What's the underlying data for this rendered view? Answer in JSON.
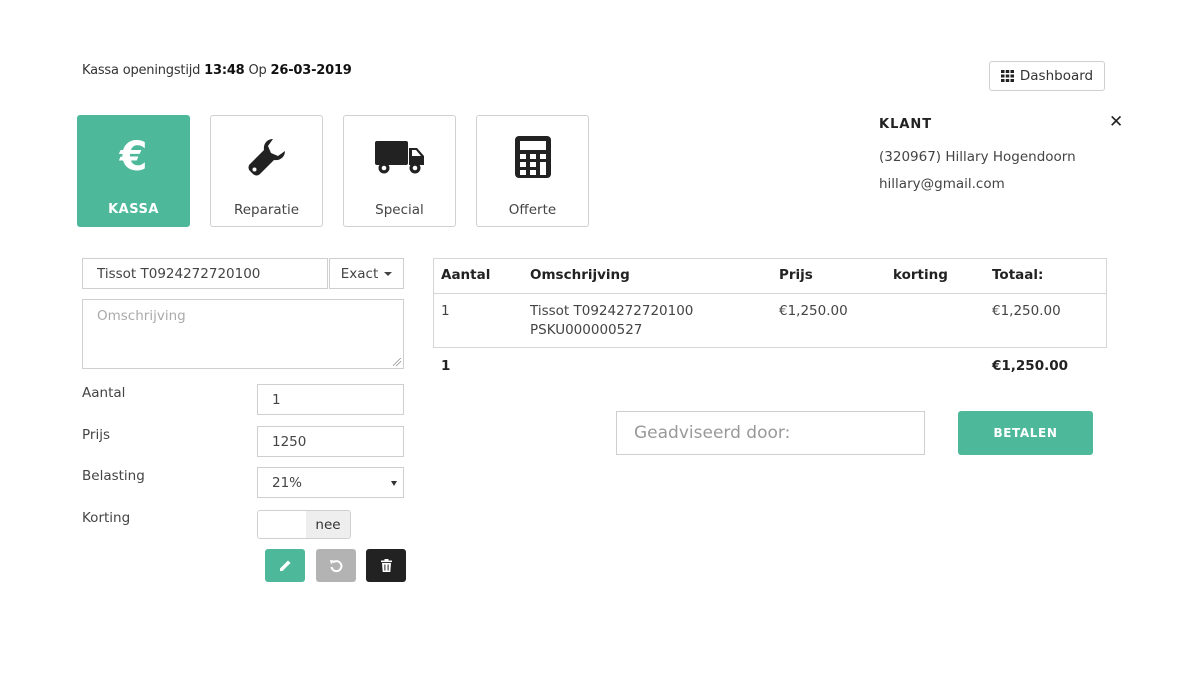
{
  "header": {
    "opening_prefix": "Kassa openingstijd",
    "opening_time": "13:48",
    "opening_on": "Op",
    "opening_date": "26-03-2019",
    "dashboard_label": "Dashboard"
  },
  "tiles": [
    {
      "label": "KASSA",
      "icon": "euro-icon",
      "active": true
    },
    {
      "label": "Reparatie",
      "icon": "wrench-icon",
      "active": false
    },
    {
      "label": "Special",
      "icon": "truck-icon",
      "active": false
    },
    {
      "label": "Offerte",
      "icon": "calculator-icon",
      "active": false
    }
  ],
  "klant": {
    "title": "KLANT",
    "name": "(320967) Hillary Hogendoorn",
    "email": "hillary@gmail.com"
  },
  "form": {
    "product_value": "Tissot T0924272720100",
    "match_mode": "Exact",
    "omschrijving_placeholder": "Omschrijving",
    "aantal_label": "Aantal",
    "aantal_value": "1",
    "prijs_label": "Prijs",
    "prijs_value": "1250",
    "belasting_label": "Belasting",
    "belasting_value": "21%",
    "korting_label": "Korting",
    "korting_value": "nee"
  },
  "table": {
    "headers": [
      "Aantal",
      "Omschrijving",
      "Prijs",
      "korting",
      "Totaal:"
    ],
    "rows": [
      {
        "aantal": "1",
        "omschrijving": "Tissot T0924272720100",
        "sku": "PSKU000000527",
        "prijs": "€1,250.00",
        "korting": "",
        "totaal": "€1,250.00"
      }
    ],
    "footer": {
      "aantal": "1",
      "totaal": "€1,250.00"
    }
  },
  "payment": {
    "advised_placeholder": "Geadviseerd door:",
    "pay_label": "BETALEN"
  },
  "colors": {
    "accent": "#4db89a",
    "grey_button": "#b3b3b3",
    "dark_button": "#222222"
  }
}
